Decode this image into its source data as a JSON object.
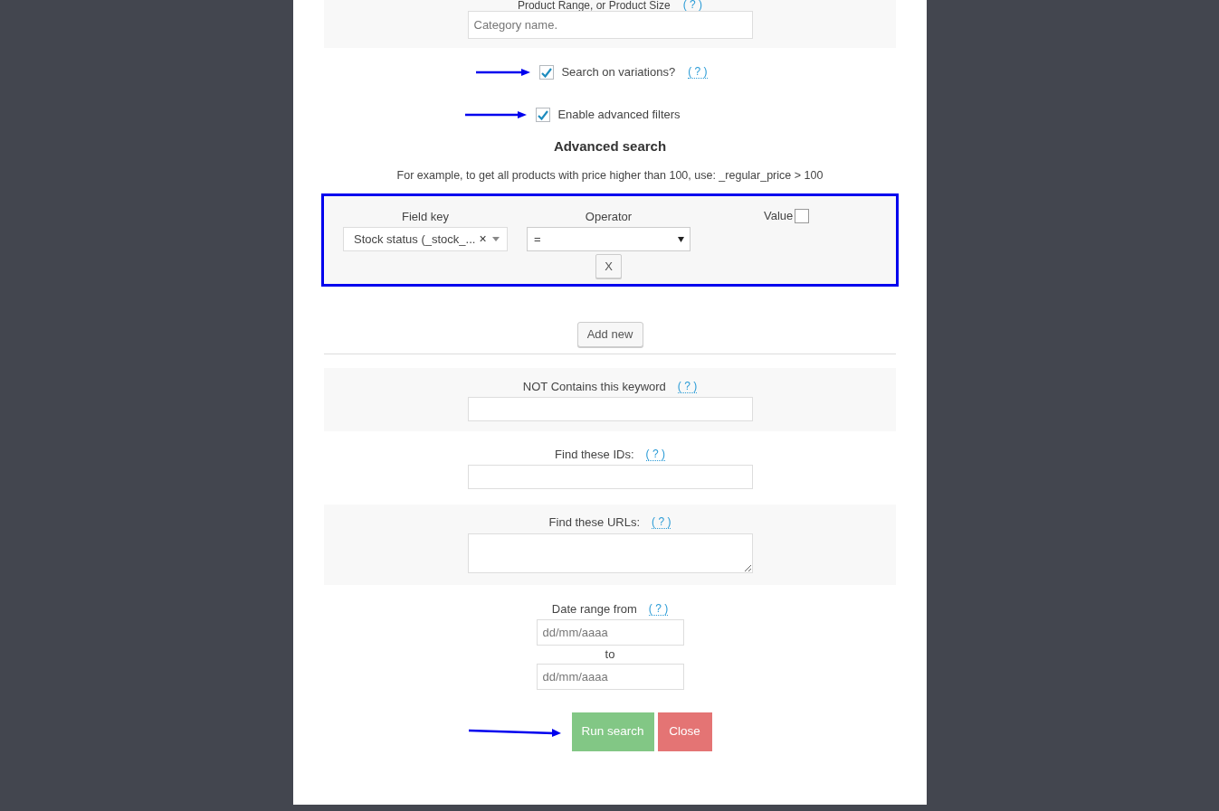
{
  "category": {
    "label": "Product Range, or Product Size",
    "help": "( ? )",
    "placeholder": "Category name."
  },
  "options": [
    {
      "label": "Search on variations?",
      "checked": true,
      "help": "( ? )",
      "highlighted": true
    },
    {
      "label": "Enable advanced filters",
      "checked": true,
      "highlighted": true
    }
  ],
  "advanced": {
    "title": "Advanced search",
    "example": "For example, to get all products with price higher than 100, use: _regular_price > 100",
    "highlighted": true,
    "field_key_label": "Field key",
    "operator_label": "Operator",
    "value_label": "Value",
    "field_key": "Stock status (_stock_...",
    "clear": "×",
    "operator": "=",
    "value_checked": false,
    "remove": "X",
    "add_button": "Add new"
  },
  "fields": [
    {
      "kind": "input",
      "label": "NOT Contains this keyword",
      "help": "( ? )",
      "shaded": true
    },
    {
      "kind": "input",
      "label": "Find these IDs:",
      "help": "( ? )",
      "shaded": false
    },
    {
      "kind": "textarea",
      "label": "Find these URLs:",
      "help": "( ? )",
      "shaded": true
    }
  ],
  "date_range": {
    "label": "Date range from",
    "help": "( ? )",
    "from_placeholder": "dd/mm/aaaa",
    "to_label": "to",
    "to_placeholder": "dd/mm/aaaa"
  },
  "buttons": [
    {
      "kind": "primary",
      "label": "Run search",
      "highlighted": true
    },
    {
      "kind": "danger",
      "label": "Close",
      "highlighted": false
    }
  ]
}
